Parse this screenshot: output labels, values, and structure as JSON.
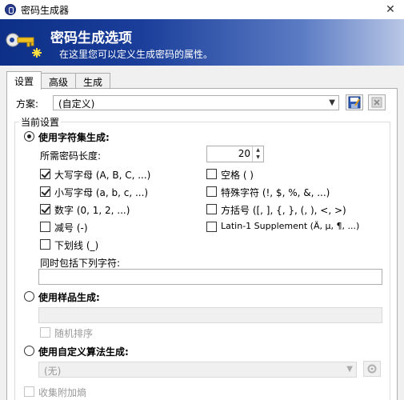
{
  "window": {
    "title": "密码生成器",
    "close_glyph": "✕"
  },
  "banner": {
    "title": "密码生成选项",
    "subtitle": "在这里您可以定义生成密码的属性。"
  },
  "tabs": [
    {
      "label": "设置"
    },
    {
      "label": "高级"
    },
    {
      "label": "生成"
    }
  ],
  "scheme": {
    "label": "方案:",
    "value": "(自定义)"
  },
  "current_settings": {
    "title": "当前设置",
    "charset": {
      "label": "使用字符集生成:",
      "length_label": "所需密码长度:",
      "length_value": "20",
      "options": [
        {
          "label": "大写字母 (A, B, C, ...)",
          "checked": true
        },
        {
          "label": "空格 ( )",
          "checked": false
        },
        {
          "label": "小写字母 (a, b, c, ...)",
          "checked": true
        },
        {
          "label": "特殊字符 (!, $, %, &, ...)",
          "checked": false
        },
        {
          "label": "数字 (0, 1, 2, ...)",
          "checked": true
        },
        {
          "label": "方括号 ([, ], {, }, (, ), <, >)",
          "checked": false
        },
        {
          "label": "减号 (-)",
          "checked": false
        },
        {
          "label": "Latin-1 Supplement (Ä, µ, ¶, ...)",
          "checked": false
        },
        {
          "label": "下划线 (_)",
          "checked": false
        }
      ],
      "include_label": "同时包括下列字符:",
      "include_value": ""
    },
    "pattern": {
      "label": "使用样品生成:",
      "value": "",
      "random_label": "随机排序"
    },
    "custom": {
      "label": "使用自定义算法生成:",
      "value": "(无)"
    },
    "collect_label": "收集附加熵"
  },
  "colors": {
    "banner_start": "#0d2f87",
    "banner_end": "#b9c7e6",
    "accent": "#1a3e9a"
  }
}
